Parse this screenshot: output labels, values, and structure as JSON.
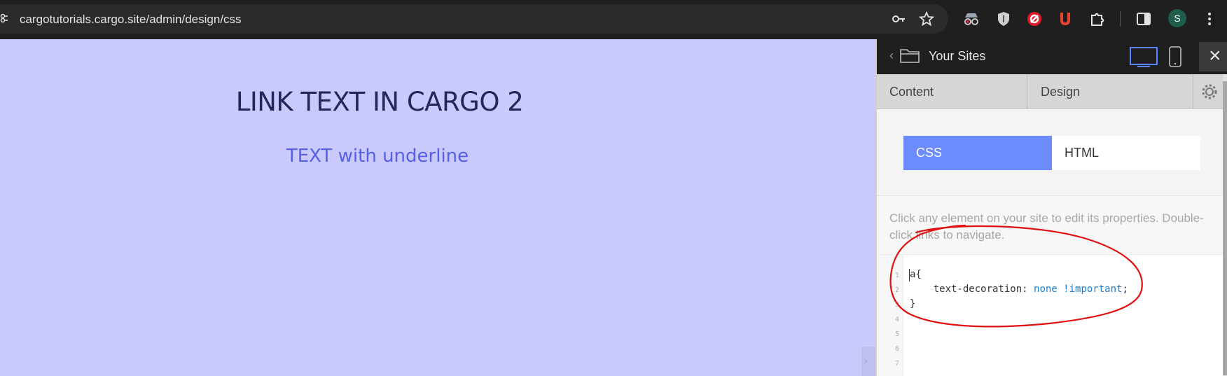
{
  "browser": {
    "url": "cargotutorials.cargo.site/admin/design/css",
    "profile_initial": "S"
  },
  "preview": {
    "title": "LINK TEXT IN CARGO 2",
    "link_text": "TEXT with underline"
  },
  "panel": {
    "header_title": "Your Sites",
    "tabs": [
      {
        "label": "Content"
      },
      {
        "label": "Design"
      }
    ],
    "mode_tabs": {
      "css": "CSS",
      "html": "HTML",
      "selected": "CSS"
    },
    "help_text": "Click any element on your site to edit its properties. Double-click links to navigate.",
    "editor": {
      "line_numbers": [
        "1",
        "2",
        "3",
        "4",
        "5",
        "6",
        "7"
      ],
      "lines": [
        {
          "selector": "a{"
        },
        {
          "property": "text-decoration: ",
          "value": "none !important",
          "end": ";"
        },
        {
          "close": "}"
        }
      ]
    }
  },
  "colors": {
    "page_background": "#c9c9fb",
    "accent": "#6b8bff",
    "annotation": "#e01010"
  }
}
